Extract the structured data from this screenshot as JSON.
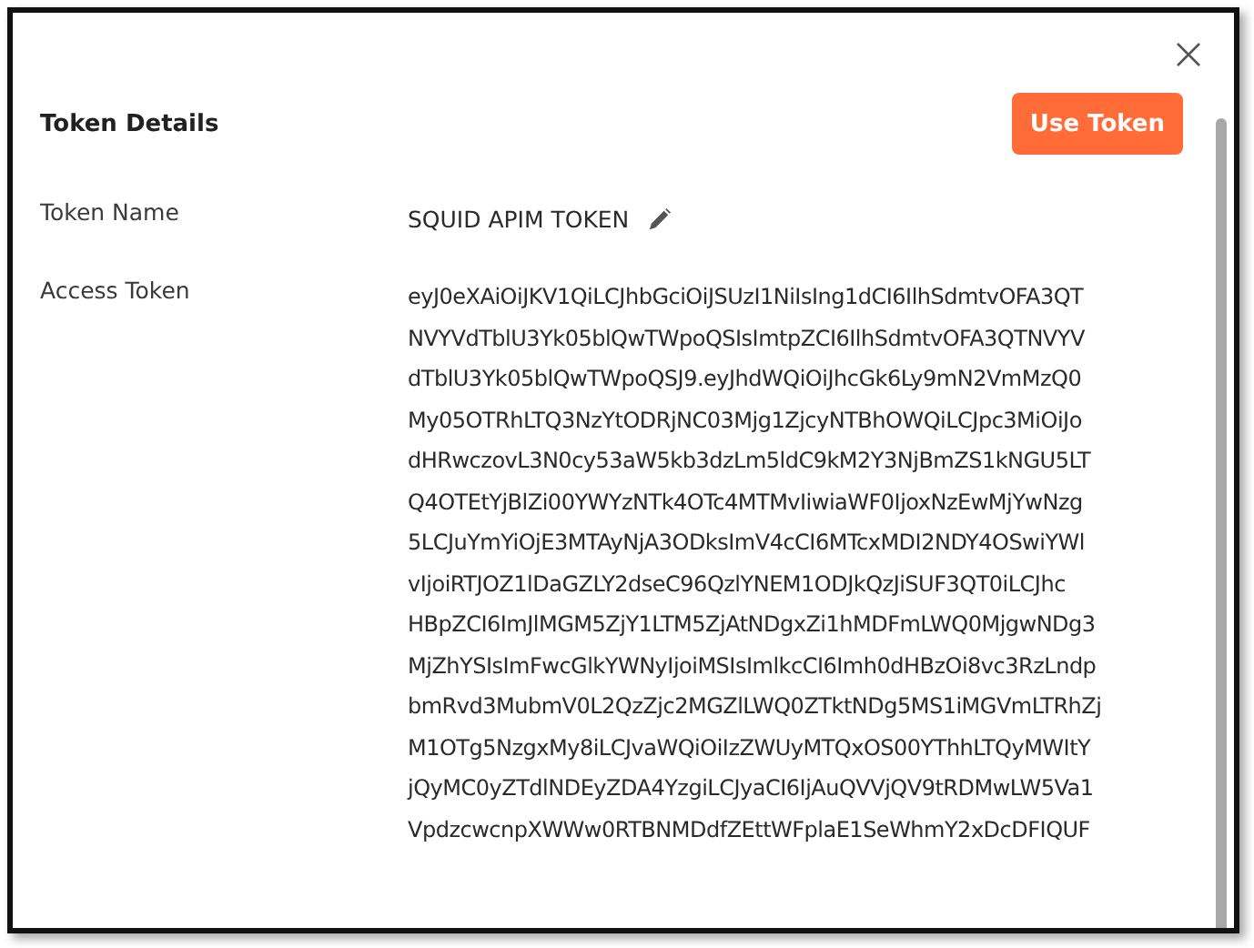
{
  "dialog": {
    "title": "Token Details",
    "primary_button": "Use Token",
    "fields": [
      {
        "label": "Token Name",
        "kind": "editable",
        "value": "SQUID APIM TOKEN"
      },
      {
        "label": "Access Token",
        "kind": "multiline",
        "lines": [
          "eyJ0eXAiOiJKV1QiLCJhbGciOiJSUzI1NiIsIng1dCI6IlhSdmtvOFA3QT",
          "NVYVdTblU3Yk05blQwTWpoQSIsImtpZCI6IlhSdmtvOFA3QTNVYV",
          "dTblU3Yk05blQwTWpoQSJ9.eyJhdWQiOiJhcGk6Ly9mN2VmMzQ0",
          "My05OTRhLTQ3NzYtODRjNC03Mjg1ZjcyNTBhOWQiLCJpc3MiOiJo",
          "dHRwczovL3N0cy53aW5kb3dzLm5ldC9kM2Y3NjBmZS1kNGU5LT",
          "Q4OTEtYjBlZi00YWYzNTk4OTc4MTMvIiwiaWF0IjoxNzEwMjYwNzg",
          "5LCJuYmYiOjE3MTAyNjA3ODksImV4cCI6MTcxMDI2NDY4OSwiYWl",
          "vIjoiRTJOZ1lDaGZLY2dseC96QzlYNEM1ODJkQzJiSUF3QT0iLCJhc",
          "HBpZCI6ImJlMGM5ZjY1LTM5ZjAtNDgxZi1hMDFmLWQ0MjgwNDg3",
          "MjZhYSIsImFwcGlkYWNyIjoiMSIsImlkcCI6Imh0dHBzOi8vc3RzLndp",
          "bmRvd3MubmV0L2QzZjc2MGZlLWQ0ZTktNDg5MS1iMGVmLTRhZj",
          "M1OTg5NzgxMy8iLCJvaWQiOiIzZWUyMTQxOS00YThhLTQyMWItY",
          "jQyMC0yZTdlNDEyZDA4YzgiLCJyaCI6IjAuQVVjQV9tRDMwLW5Va1",
          "VpdzcwcnpXWWw0RTBNMDdfZEttWFplaE1SeWhmY2xDcDFIQUF"
        ]
      }
    ]
  }
}
